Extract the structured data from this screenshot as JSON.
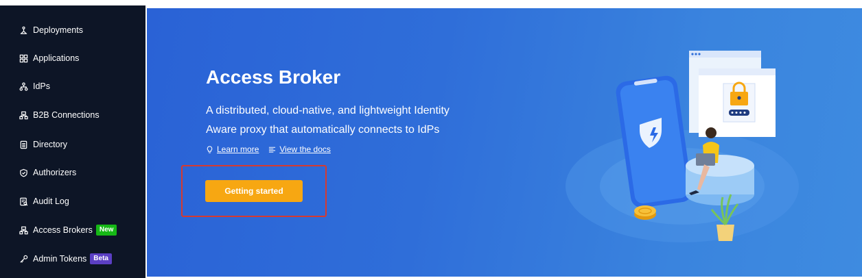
{
  "sidebar": {
    "items": [
      {
        "label": "Deployments",
        "icon": "deployments-icon"
      },
      {
        "label": "Applications",
        "icon": "applications-icon"
      },
      {
        "label": "IdPs",
        "icon": "idps-icon"
      },
      {
        "label": "B2B Connections",
        "icon": "b2b-connections-icon"
      },
      {
        "label": "Directory",
        "icon": "directory-icon"
      },
      {
        "label": "Authorizers",
        "icon": "authorizers-icon"
      },
      {
        "label": "Audit Log",
        "icon": "audit-log-icon"
      },
      {
        "label": "Access Brokers",
        "icon": "access-brokers-icon",
        "badge": "New"
      },
      {
        "label": "Admin Tokens",
        "icon": "admin-tokens-icon",
        "badge": "Beta"
      }
    ]
  },
  "hero": {
    "title": "Access Broker",
    "description_line1": "A distributed, cloud-native, and lightweight Identity",
    "description_line2": "Aware proxy that automatically connects to IdPs",
    "learn_more": "Learn more",
    "view_docs": "View the docs",
    "cta_label": "Getting started"
  },
  "colors": {
    "sidebar_bg": "#0d1526",
    "hero_bg": "#2f6ed9",
    "cta_bg": "#f7a712",
    "badge_new": "#16b816",
    "badge_beta": "#5b3fc4",
    "highlight_border": "#d63a2f"
  }
}
